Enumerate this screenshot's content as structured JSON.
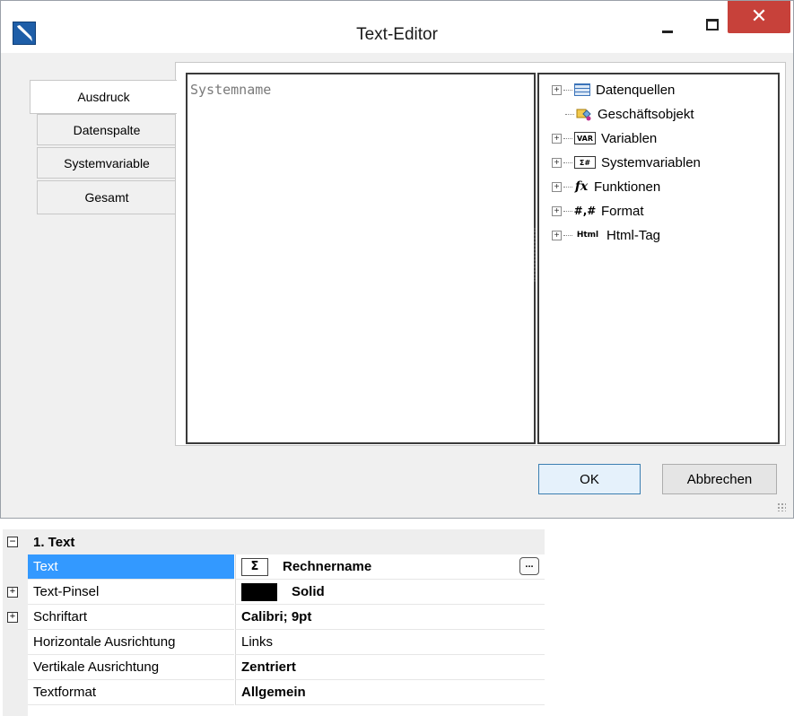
{
  "window": {
    "title": "Text-Editor",
    "close_glyph": "✕"
  },
  "tabs": [
    {
      "label": "Ausdruck",
      "active": true
    },
    {
      "label": "Datenspalte",
      "active": false
    },
    {
      "label": "Systemvariable",
      "active": false
    },
    {
      "label": "Gesamt",
      "active": false
    }
  ],
  "editor": {
    "content": "Systemname"
  },
  "tree": {
    "items": [
      {
        "label": "Datenquellen",
        "icon": "table-icon",
        "expandable": true
      },
      {
        "label": "Geschäftsobjekt",
        "icon": "business-object-icon",
        "expandable": false
      },
      {
        "label": "Variablen",
        "icon": "var-icon",
        "expandable": true,
        "icon_text": "VAR"
      },
      {
        "label": "Systemvariablen",
        "icon": "system-variable-icon",
        "expandable": true,
        "icon_text": "Σ#"
      },
      {
        "label": "Funktionen",
        "icon": "function-icon",
        "expandable": true,
        "icon_text": "fx"
      },
      {
        "label": "Format",
        "icon": "format-icon",
        "expandable": true,
        "icon_text": "#,#"
      },
      {
        "label": "Html-Tag",
        "icon": "html-icon",
        "expandable": true,
        "icon_text": "Html"
      }
    ]
  },
  "buttons": {
    "ok": "OK",
    "cancel": "Abbrechen"
  },
  "property_grid": {
    "category": "1. Text",
    "category_glyph": "−",
    "rows": [
      {
        "name": "Text",
        "value": "Rechnername",
        "selected": true,
        "bold": true,
        "expandable": false,
        "prefix": "sigma",
        "prefix_text": "Σ",
        "has_button": true,
        "button_text": "..."
      },
      {
        "name": "Text-Pinsel",
        "value": "Solid",
        "selected": false,
        "bold": true,
        "expandable": true,
        "prefix": "swatch",
        "swatch_color": "#000000"
      },
      {
        "name": "Schriftart",
        "value": "Calibri; 9pt",
        "selected": false,
        "bold": true,
        "expandable": true
      },
      {
        "name": "Horizontale Ausrichtung",
        "value": "Links",
        "selected": false,
        "bold": false,
        "expandable": false
      },
      {
        "name": "Vertikale Ausrichtung",
        "value": "Zentriert",
        "selected": false,
        "bold": true,
        "expandable": false
      },
      {
        "name": "Textformat",
        "value": "Allgemein",
        "selected": false,
        "bold": true,
        "expandable": false
      }
    ],
    "expand_glyph": "+"
  },
  "colors": {
    "selection": "#3399ff",
    "close_button": "#c7413a",
    "default_button_border": "#3c7fb1"
  }
}
